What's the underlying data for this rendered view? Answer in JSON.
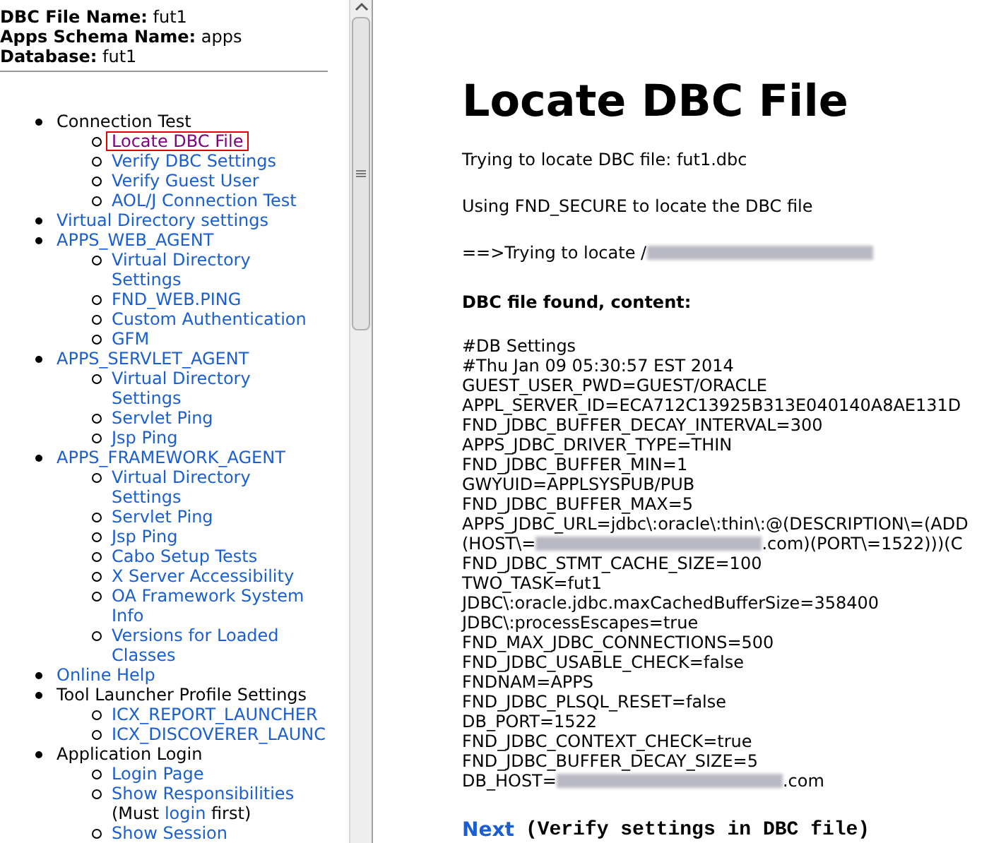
{
  "header": {
    "fields": [
      {
        "label": "DBC File Name:",
        "value": "fut1"
      },
      {
        "label": "Apps Schema Name:",
        "value": "apps"
      },
      {
        "label": "Database:",
        "value": "fut1"
      }
    ]
  },
  "nav": {
    "items": [
      {
        "text": "Connection Test",
        "kind": "text",
        "children": [
          {
            "text": "Locate DBC File",
            "selected": true
          },
          {
            "text": "Verify DBC Settings",
            "selected": false
          },
          {
            "text": "Verify Guest User",
            "selected": false
          },
          {
            "text": "AOL/J Connection Test",
            "selected": false
          }
        ]
      },
      {
        "text": "Virtual Directory settings",
        "kind": "link"
      },
      {
        "text": "APPS_WEB_AGENT",
        "kind": "link",
        "children": [
          {
            "text": "Virtual Directory Settings",
            "selected": false
          },
          {
            "text": "FND_WEB.PING",
            "selected": false
          },
          {
            "text": "Custom Authentication",
            "selected": false
          },
          {
            "text": "GFM",
            "selected": false
          }
        ]
      },
      {
        "text": "APPS_SERVLET_AGENT",
        "kind": "link",
        "children": [
          {
            "text": "Virtual Directory Settings",
            "selected": false
          },
          {
            "text": "Servlet Ping",
            "selected": false
          },
          {
            "text": "Jsp Ping",
            "selected": false
          }
        ]
      },
      {
        "text": "APPS_FRAMEWORK_AGENT",
        "kind": "link",
        "children": [
          {
            "text": "Virtual Directory Settings",
            "selected": false
          },
          {
            "text": "Servlet Ping",
            "selected": false
          },
          {
            "text": "Jsp Ping",
            "selected": false
          },
          {
            "text": "Cabo Setup Tests",
            "selected": false
          },
          {
            "text": "X Server Accessibility",
            "selected": false
          },
          {
            "text": "OA Framework System Info",
            "selected": false
          },
          {
            "text": "Versions for Loaded Classes",
            "selected": false
          }
        ]
      },
      {
        "text": "Online Help",
        "kind": "link"
      },
      {
        "text": "Tool Launcher Profile Settings",
        "kind": "text",
        "children": [
          {
            "text": "ICX_REPORT_LAUNCHER",
            "selected": false
          },
          {
            "text": "ICX_DISCOVERER_LAUNC",
            "selected": false
          }
        ]
      },
      {
        "text": "Application Login",
        "kind": "text",
        "children": [
          {
            "text": "Login Page",
            "selected": false
          },
          {
            "text": "Show Responsibilities",
            "selected": false,
            "note": {
              "before": "(Must",
              "link": "login",
              "after": "first)"
            }
          },
          {
            "text": "Show Session",
            "selected": false
          }
        ]
      }
    ]
  },
  "main": {
    "title": "Locate DBC File",
    "messages": [
      {
        "parts": [
          {
            "kind": "text",
            "text": "Trying to locate DBC file: fut1.dbc"
          }
        ]
      },
      {
        "parts": [
          {
            "kind": "text",
            "text": "Using FND_SECURE to locate the DBC file"
          }
        ]
      },
      {
        "parts": [
          {
            "kind": "text",
            "text": "==>Trying to locate /"
          },
          {
            "kind": "blurred"
          }
        ]
      }
    ],
    "content_heading": "DBC file found, content:",
    "lines": [
      {
        "parts": [
          {
            "kind": "text",
            "text": "#DB Settings"
          }
        ]
      },
      {
        "parts": [
          {
            "kind": "text",
            "text": "#Thu Jan 09 05:30:57 EST 2014"
          }
        ]
      },
      {
        "parts": [
          {
            "kind": "text",
            "text": "GUEST_USER_PWD=GUEST/ORACLE"
          }
        ]
      },
      {
        "parts": [
          {
            "kind": "text",
            "text": "APPL_SERVER_ID=ECA712C13925B313E040140A8AE131D"
          }
        ]
      },
      {
        "parts": [
          {
            "kind": "text",
            "text": "FND_JDBC_BUFFER_DECAY_INTERVAL=300"
          }
        ]
      },
      {
        "parts": [
          {
            "kind": "text",
            "text": "APPS_JDBC_DRIVER_TYPE=THIN"
          }
        ]
      },
      {
        "parts": [
          {
            "kind": "text",
            "text": "FND_JDBC_BUFFER_MIN=1"
          }
        ]
      },
      {
        "parts": [
          {
            "kind": "text",
            "text": "GWYUID=APPLSYSPUB/PUB"
          }
        ]
      },
      {
        "parts": [
          {
            "kind": "text",
            "text": "FND_JDBC_BUFFER_MAX=5"
          }
        ]
      },
      {
        "parts": [
          {
            "kind": "text",
            "text": "APPS_JDBC_URL=jdbc\\:oracle\\:thin\\:@(DESCRIPTION\\=(ADD"
          }
        ]
      },
      {
        "parts": [
          {
            "kind": "text",
            "text": "(HOST\\="
          },
          {
            "kind": "blurred"
          },
          {
            "kind": "text",
            "text": ".com)(PORT\\=1522)))(C"
          }
        ]
      },
      {
        "parts": [
          {
            "kind": "text",
            "text": "FND_JDBC_STMT_CACHE_SIZE=100"
          }
        ]
      },
      {
        "parts": [
          {
            "kind": "text",
            "text": "TWO_TASK=fut1"
          }
        ]
      },
      {
        "parts": [
          {
            "kind": "text",
            "text": "JDBC\\:oracle.jdbc.maxCachedBufferSize=358400"
          }
        ]
      },
      {
        "parts": [
          {
            "kind": "text",
            "text": "JDBC\\:processEscapes=true"
          }
        ]
      },
      {
        "parts": [
          {
            "kind": "text",
            "text": "FND_MAX_JDBC_CONNECTIONS=500"
          }
        ]
      },
      {
        "parts": [
          {
            "kind": "text",
            "text": "FND_JDBC_USABLE_CHECK=false"
          }
        ]
      },
      {
        "parts": [
          {
            "kind": "text",
            "text": "FNDNAM=APPS"
          }
        ]
      },
      {
        "parts": [
          {
            "kind": "text",
            "text": "FND_JDBC_PLSQL_RESET=false"
          }
        ]
      },
      {
        "parts": [
          {
            "kind": "text",
            "text": "DB_PORT=1522"
          }
        ]
      },
      {
        "parts": [
          {
            "kind": "text",
            "text": "FND_JDBC_CONTEXT_CHECK=true"
          }
        ]
      },
      {
        "parts": [
          {
            "kind": "text",
            "text": "FND_JDBC_BUFFER_DECAY_SIZE=5"
          }
        ]
      },
      {
        "parts": [
          {
            "kind": "text",
            "text": "DB_HOST="
          },
          {
            "kind": "blurred"
          },
          {
            "kind": "text",
            "text": ".com"
          }
        ]
      }
    ],
    "next": {
      "link": "Next",
      "description": "(Verify settings in DBC file)"
    }
  }
}
